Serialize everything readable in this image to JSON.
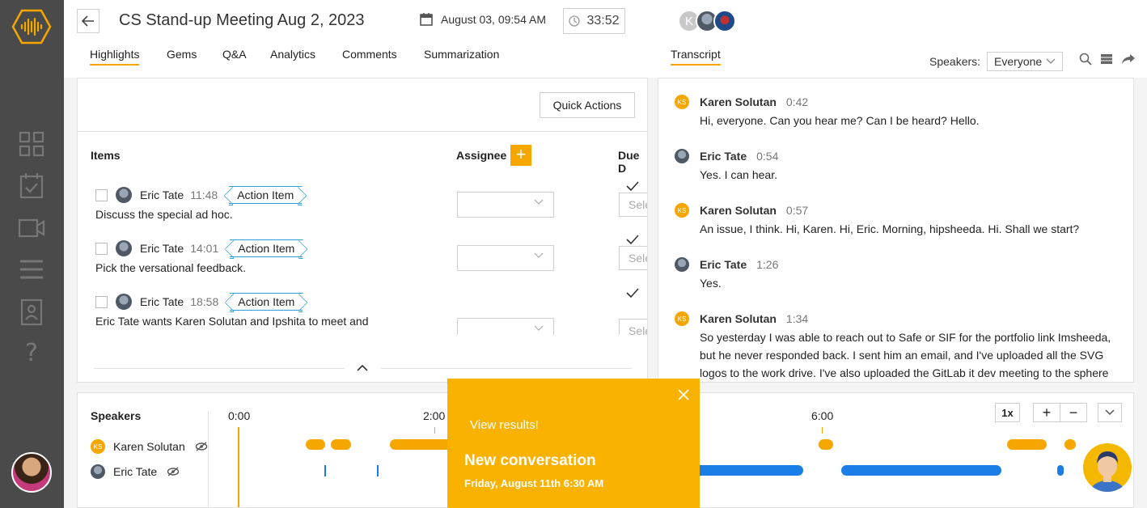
{
  "header": {
    "title": "CS Stand-up Meeting Aug 2, 2023",
    "date": "August 03, 09:54 AM",
    "duration": "33:52",
    "participant_initial": "K"
  },
  "tabs": [
    "Highlights",
    "Gems",
    "Q&A",
    "Analytics",
    "Comments",
    "Summarization"
  ],
  "transcript_tab": "Transcript",
  "speakers_filter": {
    "label": "Speakers:",
    "value": "Everyone"
  },
  "highlights": {
    "quick_actions": "Quick Actions",
    "col_items": "Items",
    "col_assignee": "Assignee",
    "col_due": "Due D",
    "add_symbol": "+",
    "select_placeholder": "Sele",
    "items": [
      {
        "name": "Eric Tate",
        "time": "11:48",
        "tag": "Action Item",
        "text": "Discuss the special ad hoc."
      },
      {
        "name": "Eric Tate",
        "time": "14:01",
        "tag": "Action Item",
        "text": "Pick the versational feedback."
      },
      {
        "name": "Eric Tate",
        "time": "18:58",
        "tag": "Action Item",
        "text": "Eric Tate wants Karen Solutan and Ipshita to meet and"
      }
    ]
  },
  "transcript": [
    {
      "badge": "KS",
      "name": "Karen Solutan",
      "time": "0:42",
      "text": "Hi, everyone. Can you hear me? Can I be heard? Hello."
    },
    {
      "badge": "",
      "name": "Eric Tate",
      "time": "0:54",
      "text": "Yes. I can hear."
    },
    {
      "badge": "KS",
      "name": "Karen Solutan",
      "time": "0:57",
      "text": "An issue, I think. Hi, Karen. Hi, Eric. Morning, hipsheeda. Hi. Shall we start?"
    },
    {
      "badge": "",
      "name": "Eric Tate",
      "time": "1:26",
      "text": "Yes."
    },
    {
      "badge": "KS",
      "name": "Karen Solutan",
      "time": "1:34",
      "text": "So yesterday I was able to reach out to Safe or SIF for the portfolio link Imsheeda, but he never responded back. I sent him an email, and I've uploaded all the SVG logos to the work drive. I've also uploaded the GitLab it dev meeting to the sphere"
    }
  ],
  "timeline": {
    "speakers_label": "Speakers",
    "speakers": [
      {
        "badge": "KS",
        "name": "Karen Solutan"
      },
      {
        "badge": "",
        "name": "Eric Tate"
      }
    ],
    "time_labels": [
      "0:00",
      "2:00",
      "6:00"
    ],
    "speed": "1x",
    "zoom_in": "+",
    "zoom_out": "−"
  },
  "popup": {
    "subtitle": "View results!",
    "headline": "New conversation",
    "date": "Friday, August 11th 6:30 AM"
  }
}
